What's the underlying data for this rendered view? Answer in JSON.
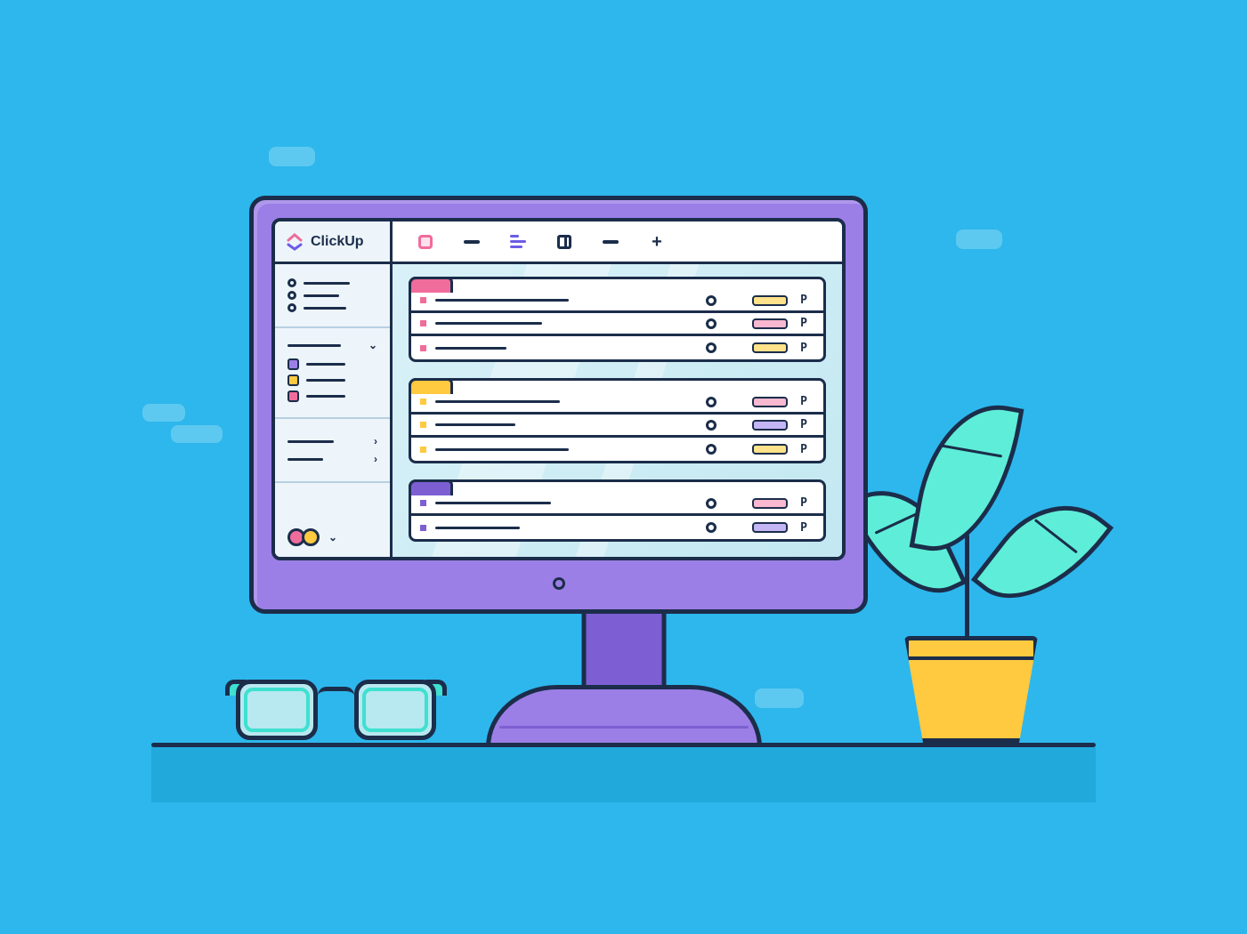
{
  "app_name": "ClickUp",
  "colors": {
    "pink": "#F06C9B",
    "yellow": "#FFC940",
    "purple": "#7D5FD3",
    "navy": "#1B2D4A",
    "lilac": "#9B7FE6",
    "sky": "#2DB7ED",
    "mint": "#5EEDD8"
  },
  "sidebar": {
    "spaces": [
      {
        "color": "purple"
      },
      {
        "color": "yellow"
      },
      {
        "color": "pink"
      }
    ]
  },
  "groups": [
    {
      "tab_color": "pink",
      "rows": [
        {
          "dot": "pink",
          "title_w": 150,
          "tag": "yellow",
          "priority": "P"
        },
        {
          "dot": "pink",
          "title_w": 120,
          "tag": "pink",
          "priority": "P"
        },
        {
          "dot": "pink",
          "title_w": 80,
          "tag": "yellow",
          "priority": "P"
        }
      ]
    },
    {
      "tab_color": "yellow",
      "rows": [
        {
          "dot": "yellow",
          "title_w": 140,
          "tag": "pink",
          "priority": "P"
        },
        {
          "dot": "yellow",
          "title_w": 90,
          "tag": "purple",
          "priority": "P"
        },
        {
          "dot": "yellow",
          "title_w": 150,
          "tag": "yellow",
          "priority": "P"
        }
      ]
    },
    {
      "tab_color": "purple",
      "rows": [
        {
          "dot": "purple",
          "title_w": 130,
          "tag": "pink",
          "priority": "P"
        },
        {
          "dot": "purple",
          "title_w": 95,
          "tag": "purple",
          "priority": "P"
        }
      ]
    }
  ]
}
